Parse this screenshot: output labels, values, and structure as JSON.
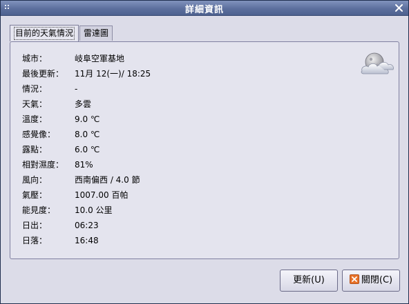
{
  "window": {
    "title": "詳細資訊"
  },
  "tabs": [
    {
      "label": "目前的天氣情況",
      "active": true
    },
    {
      "label": "雷達圖",
      "active": false
    }
  ],
  "details": [
    {
      "label": "城市：",
      "value": "岐阜空軍基地"
    },
    {
      "label": "最後更新：",
      "value": "11月 12(一)/ 18:25"
    },
    {
      "label": "情況：",
      "value": "-"
    },
    {
      "label": "天氣：",
      "value": "多雲"
    },
    {
      "label": "溫度：",
      "value": "9.0 ℃"
    },
    {
      "label": "感覺像：",
      "value": "8.0 ℃"
    },
    {
      "label": "露點：",
      "value": "6.0 ℃"
    },
    {
      "label": "相對濕度：",
      "value": "81%"
    },
    {
      "label": "風向：",
      "value": "西南偏西 / 4.0 節"
    },
    {
      "label": "氣壓：",
      "value": "1007.00 百帕"
    },
    {
      "label": "能見度：",
      "value": "10.0 公里"
    },
    {
      "label": "日出：",
      "value": "06:23"
    },
    {
      "label": "日落：",
      "value": "16:48"
    }
  ],
  "weather_icon": "cloudy-night-icon",
  "buttons": {
    "update_label": "更新(U)",
    "close_label": "關閉(C)"
  },
  "colors": {
    "titlebar": "#5c6f9d",
    "background": "#dcdce8",
    "panel": "#e4e4ee",
    "close_icon_accent": "#e8732a"
  }
}
